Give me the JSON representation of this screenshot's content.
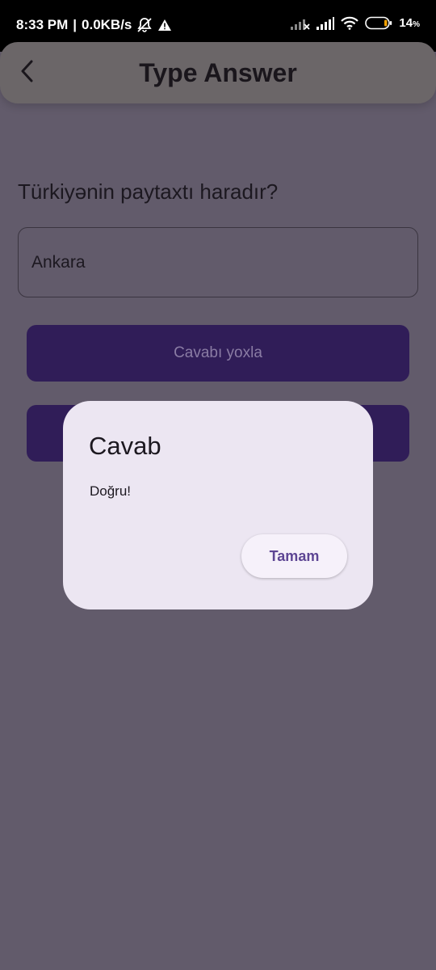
{
  "status_bar": {
    "time": "8:33 PM",
    "separator": "|",
    "speed": "0.0KB/s",
    "battery": "14",
    "battery_unit": "%",
    "left_icons": [
      "bell-off-icon",
      "warning-icon"
    ],
    "right_icons": [
      "signal-no-icon",
      "signal-icon",
      "wifi-icon",
      "battery-icon"
    ]
  },
  "appbar": {
    "title": "Type Answer",
    "back_icon": "chevron-left-icon"
  },
  "main": {
    "question": "Türkiyənin paytaxtı haradır?",
    "answer_value": "Ankara",
    "check_button_label": "Cavabı yoxla"
  },
  "dialog": {
    "title": "Cavab",
    "message": "Doğru!",
    "ok_label": "Tamam"
  },
  "colors": {
    "scrim": "#625b6b",
    "primary_button": "#301d58",
    "dialog_bg": "#ece6f2",
    "accent_text": "#5e4694"
  }
}
